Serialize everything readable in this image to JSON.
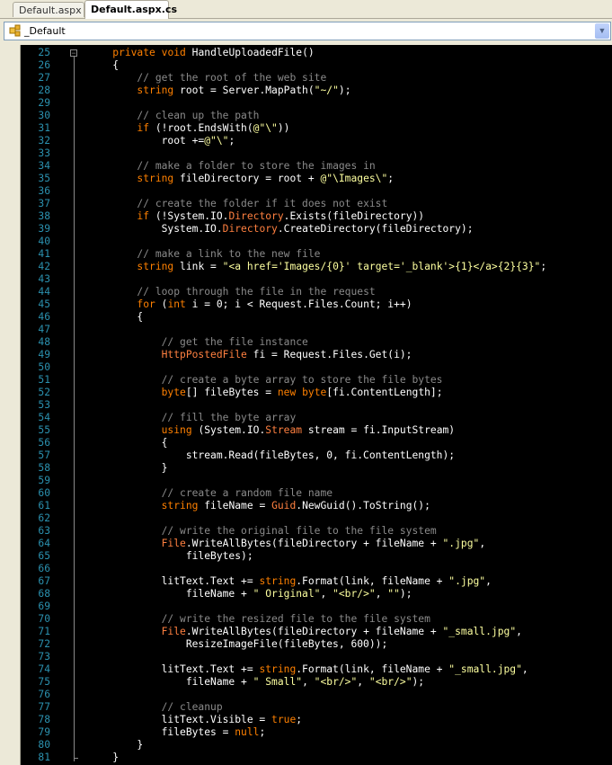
{
  "tabs": [
    {
      "label": "Default.aspx",
      "active": false
    },
    {
      "label": "Default.aspx.cs",
      "active": true
    }
  ],
  "navigation": {
    "selected": "_Default"
  },
  "code_lines": [
    {
      "n": "25",
      "text": "    private void HandleUploadedFile()"
    },
    {
      "n": "26",
      "text": "    {"
    },
    {
      "n": "27",
      "text": "        // get the root of the web site"
    },
    {
      "n": "28",
      "text": "        string root = Server.MapPath(\"~/\");"
    },
    {
      "n": "29",
      "text": ""
    },
    {
      "n": "30",
      "text": "        // clean up the path"
    },
    {
      "n": "31",
      "text": "        if (!root.EndsWith(@\"\\\"))"
    },
    {
      "n": "32",
      "text": "            root +=@\"\\\";"
    },
    {
      "n": "33",
      "text": ""
    },
    {
      "n": "34",
      "text": "        // make a folder to store the images in"
    },
    {
      "n": "35",
      "text": "        string fileDirectory = root + @\"\\Images\\\";"
    },
    {
      "n": "36",
      "text": ""
    },
    {
      "n": "37",
      "text": "        // create the folder if it does not exist"
    },
    {
      "n": "38",
      "text": "        if (!System.IO.Directory.Exists(fileDirectory))"
    },
    {
      "n": "39",
      "text": "            System.IO.Directory.CreateDirectory(fileDirectory);"
    },
    {
      "n": "40",
      "text": ""
    },
    {
      "n": "41",
      "text": "        // make a link to the new file"
    },
    {
      "n": "42",
      "text": "        string link = \"<a href='Images/{0}' target='_blank'>{1}</a>{2}{3}\";"
    },
    {
      "n": "43",
      "text": ""
    },
    {
      "n": "44",
      "text": "        // loop through the file in the request"
    },
    {
      "n": "45",
      "text": "        for (int i = 0; i < Request.Files.Count; i++)"
    },
    {
      "n": "46",
      "text": "        {"
    },
    {
      "n": "47",
      "text": ""
    },
    {
      "n": "48",
      "text": "            // get the file instance"
    },
    {
      "n": "49",
      "text": "            HttpPostedFile fi = Request.Files.Get(i);"
    },
    {
      "n": "50",
      "text": ""
    },
    {
      "n": "51",
      "text": "            // create a byte array to store the file bytes"
    },
    {
      "n": "52",
      "text": "            byte[] fileBytes = new byte[fi.ContentLength];"
    },
    {
      "n": "53",
      "text": ""
    },
    {
      "n": "54",
      "text": "            // fill the byte array"
    },
    {
      "n": "55",
      "text": "            using (System.IO.Stream stream = fi.InputStream)"
    },
    {
      "n": "56",
      "text": "            {"
    },
    {
      "n": "57",
      "text": "                stream.Read(fileBytes, 0, fi.ContentLength);"
    },
    {
      "n": "58",
      "text": "            }"
    },
    {
      "n": "59",
      "text": ""
    },
    {
      "n": "60",
      "text": "            // create a random file name"
    },
    {
      "n": "61",
      "text": "            string fileName = Guid.NewGuid().ToString();"
    },
    {
      "n": "62",
      "text": ""
    },
    {
      "n": "63",
      "text": "            // write the original file to the file system"
    },
    {
      "n": "64",
      "text": "            File.WriteAllBytes(fileDirectory + fileName + \".jpg\","
    },
    {
      "n": "65",
      "text": "                fileBytes);"
    },
    {
      "n": "66",
      "text": ""
    },
    {
      "n": "67",
      "text": "            litText.Text += string.Format(link, fileName + \".jpg\","
    },
    {
      "n": "68",
      "text": "                fileName + \" Original\", \"<br/>\", \"\");"
    },
    {
      "n": "69",
      "text": ""
    },
    {
      "n": "70",
      "text": "            // write the resized file to the file system"
    },
    {
      "n": "71",
      "text": "            File.WriteAllBytes(fileDirectory + fileName + \"_small.jpg\","
    },
    {
      "n": "72",
      "text": "                ResizeImageFile(fileBytes, 600));"
    },
    {
      "n": "73",
      "text": ""
    },
    {
      "n": "74",
      "text": "            litText.Text += string.Format(link, fileName + \"_small.jpg\","
    },
    {
      "n": "75",
      "text": "                fileName + \" Small\", \"<br/>\", \"<br/>\");"
    },
    {
      "n": "76",
      "text": ""
    },
    {
      "n": "77",
      "text": "            // cleanup"
    },
    {
      "n": "78",
      "text": "            litText.Visible = true;"
    },
    {
      "n": "79",
      "text": "            fileBytes = null;"
    },
    {
      "n": "80",
      "text": "        }"
    },
    {
      "n": "81",
      "text": "    }"
    }
  ],
  "colors": {
    "background": "#000000",
    "keyword": "#ff8000",
    "string": "#fdff9f",
    "comment": "#8a8a8a",
    "line_number": "#2b91af",
    "default_text": "#ffffff"
  }
}
